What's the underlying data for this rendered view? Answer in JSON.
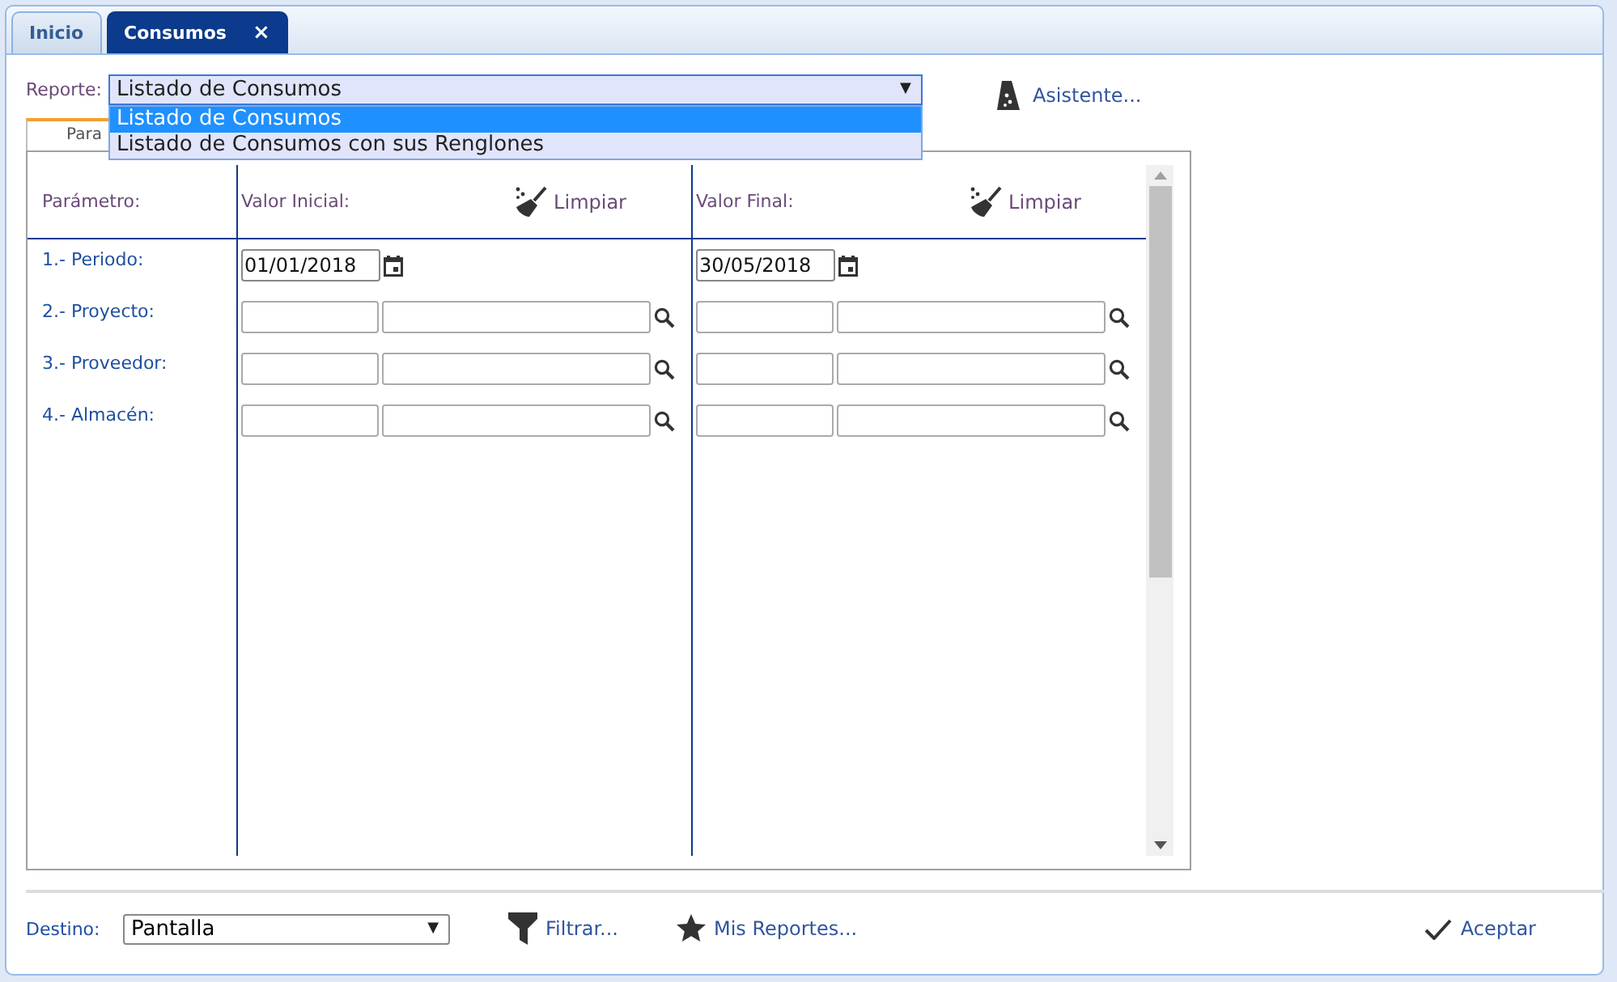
{
  "tabs": [
    {
      "label": "Inicio",
      "selected": false
    },
    {
      "label": "Consumos",
      "selected": true,
      "close": "×"
    }
  ],
  "report": {
    "label": "Reporte:",
    "value": "Listado de Consumos",
    "caret": "▼",
    "expanded": true,
    "options": [
      {
        "label": "Listado de Consumos",
        "selected": true
      },
      {
        "label": "Listado de Consumos con sus Renglones",
        "selected": false
      }
    ]
  },
  "wizard": "Asistente...",
  "panel_tab": {
    "label": "Para",
    "selected": true
  },
  "grid": {
    "param_header": "Parámetro:",
    "initial_header": "Valor Inicial:",
    "final_header": "Valor Final:",
    "clear_initial": "Limpiar",
    "clear_final": "Limpiar",
    "params": [
      {
        "label": "1.- Periodo:",
        "kind": "date",
        "initial": "01/01/2018",
        "final": "30/05/2018"
      },
      {
        "label": "2.- Proyecto:",
        "kind": "lookup"
      },
      {
        "label": "3.- Proveedor:",
        "kind": "lookup"
      },
      {
        "label": "4.- Almacén:",
        "kind": "lookup"
      }
    ]
  },
  "footer": {
    "destination_label": "Destino:",
    "destination": "Pantalla",
    "caret": "▼",
    "filter": "Filtrar...",
    "my_reports": "Mis Reportes...",
    "accept": "Aceptar"
  }
}
